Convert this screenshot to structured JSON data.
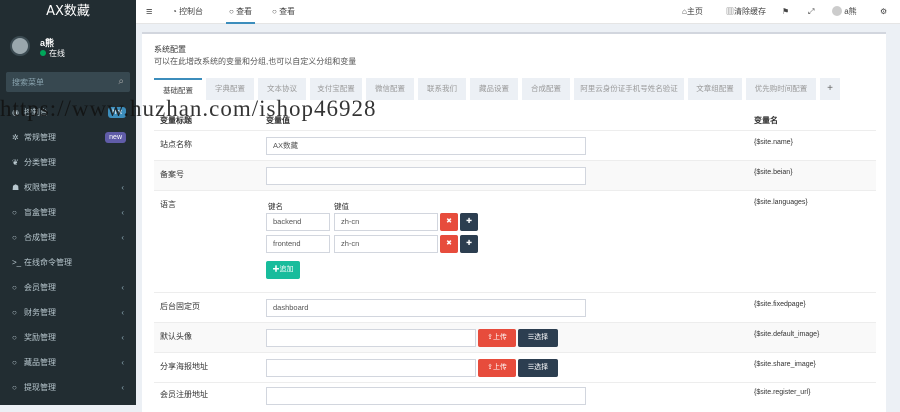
{
  "brand": "AX数藏",
  "user": {
    "name": "a熊",
    "status": "在线"
  },
  "search_placeholder": "搜索菜单",
  "menu": [
    {
      "label": "控制台",
      "badge": "hot",
      "arrow": false
    },
    {
      "label": "常规管理",
      "badge": "new",
      "arrow": false
    },
    {
      "label": "分类管理",
      "badge": "",
      "arrow": false
    },
    {
      "label": "权限管理",
      "badge": "",
      "arrow": true
    },
    {
      "label": "盲盒管理",
      "badge": "",
      "arrow": true
    },
    {
      "label": "合成管理",
      "badge": "",
      "arrow": true
    },
    {
      "label": "在线命令管理",
      "badge": "",
      "arrow": false
    },
    {
      "label": "会员管理",
      "badge": "",
      "arrow": true
    },
    {
      "label": "财务管理",
      "badge": "",
      "arrow": true
    },
    {
      "label": "奖励管理",
      "badge": "",
      "arrow": true
    },
    {
      "label": "藏品管理",
      "badge": "",
      "arrow": true
    },
    {
      "label": "提现管理",
      "badge": "",
      "arrow": true
    }
  ],
  "topbar": {
    "menu_icon": "≡",
    "tab1": "控制台",
    "tab2": "查看",
    "tab3": "查看",
    "home": "主页",
    "clear_cache": "清除缓存",
    "user": "a熊"
  },
  "page": {
    "title": "系统配置",
    "subtitle": "可以在此增改系统的变量和分组,也可以自定义分组和变量"
  },
  "tabs": [
    "基础配置",
    "字典配置",
    "文本协议",
    "支付宝配置",
    "微信配置",
    "联系我们",
    "藏品设置",
    "合成配置",
    "阿里云身份证手机号姓名验证",
    "文章组配置",
    "优先购时间配置",
    "+"
  ],
  "table": {
    "col_title": "变量标题",
    "col_value": "变量值",
    "col_name": "变量名"
  },
  "rows": [
    {
      "title": "站点名称",
      "value": "AX数藏",
      "name": "{$site.name}"
    },
    {
      "title": "备案号",
      "value": "",
      "name": "{$site.beian}"
    },
    {
      "title": "语言",
      "name": "{$site.languages}"
    },
    {
      "title": "后台固定页",
      "value": "dashboard",
      "name": "{$site.fixedpage}"
    },
    {
      "title": "默认头像",
      "value": "",
      "name": "{$site.default_image}"
    },
    {
      "title": "分享海报地址",
      "value": "",
      "name": "{$site.share_image}"
    },
    {
      "title": "会员注册地址",
      "value": "",
      "name": "{$site.register_url}"
    }
  ],
  "languages": {
    "key_header": "键名",
    "value_header": "键值",
    "items": [
      {
        "key": "backend",
        "value": "zh-cn"
      },
      {
        "key": "frontend",
        "value": "zh-cn"
      }
    ],
    "add_label": "追加"
  },
  "buttons": {
    "upload": "上传",
    "select": "选择"
  },
  "watermark": "https://www.huzhan.com/ishop46928"
}
